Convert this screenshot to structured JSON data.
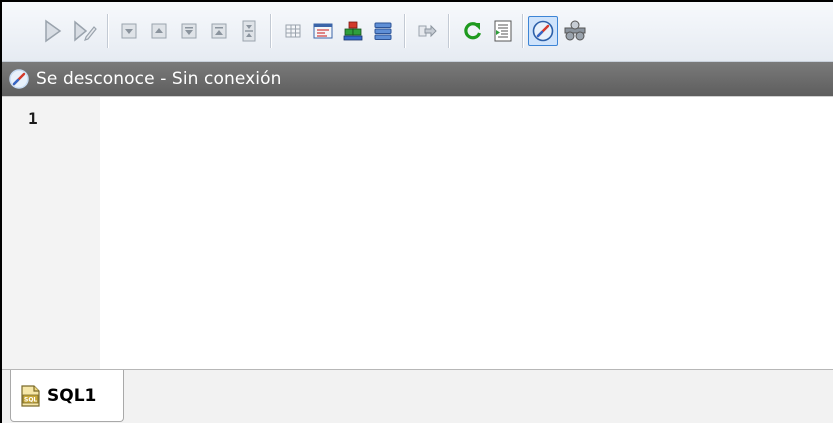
{
  "toolbar": {
    "buttons": [
      {
        "name": "execute-icon"
      },
      {
        "name": "execute-for-edit-icon"
      },
      {
        "name": "next-result-icon"
      },
      {
        "name": "previous-result-icon"
      },
      {
        "name": "first-result-icon"
      },
      {
        "name": "last-result-icon"
      },
      {
        "name": "expand-results-icon"
      },
      {
        "name": "grid-view-icon"
      },
      {
        "name": "text-view-icon"
      },
      {
        "name": "stacked-view-icon"
      },
      {
        "name": "list-view-icon"
      },
      {
        "name": "export-icon"
      },
      {
        "name": "refresh-icon"
      },
      {
        "name": "script-icon"
      },
      {
        "name": "connection-icon"
      },
      {
        "name": "options-icon"
      }
    ]
  },
  "status": {
    "text": "Se desconoce - Sin conexión",
    "icon": "connection-status-icon"
  },
  "editor": {
    "line_numbers": [
      "1"
    ]
  },
  "tabs": [
    {
      "label": "SQL1",
      "icon": "sql-file-icon"
    }
  ],
  "colors": {
    "status_bar": "#6b6b6b",
    "active_button_border": "#3d85d6",
    "refresh_green": "#1f9a1f"
  }
}
